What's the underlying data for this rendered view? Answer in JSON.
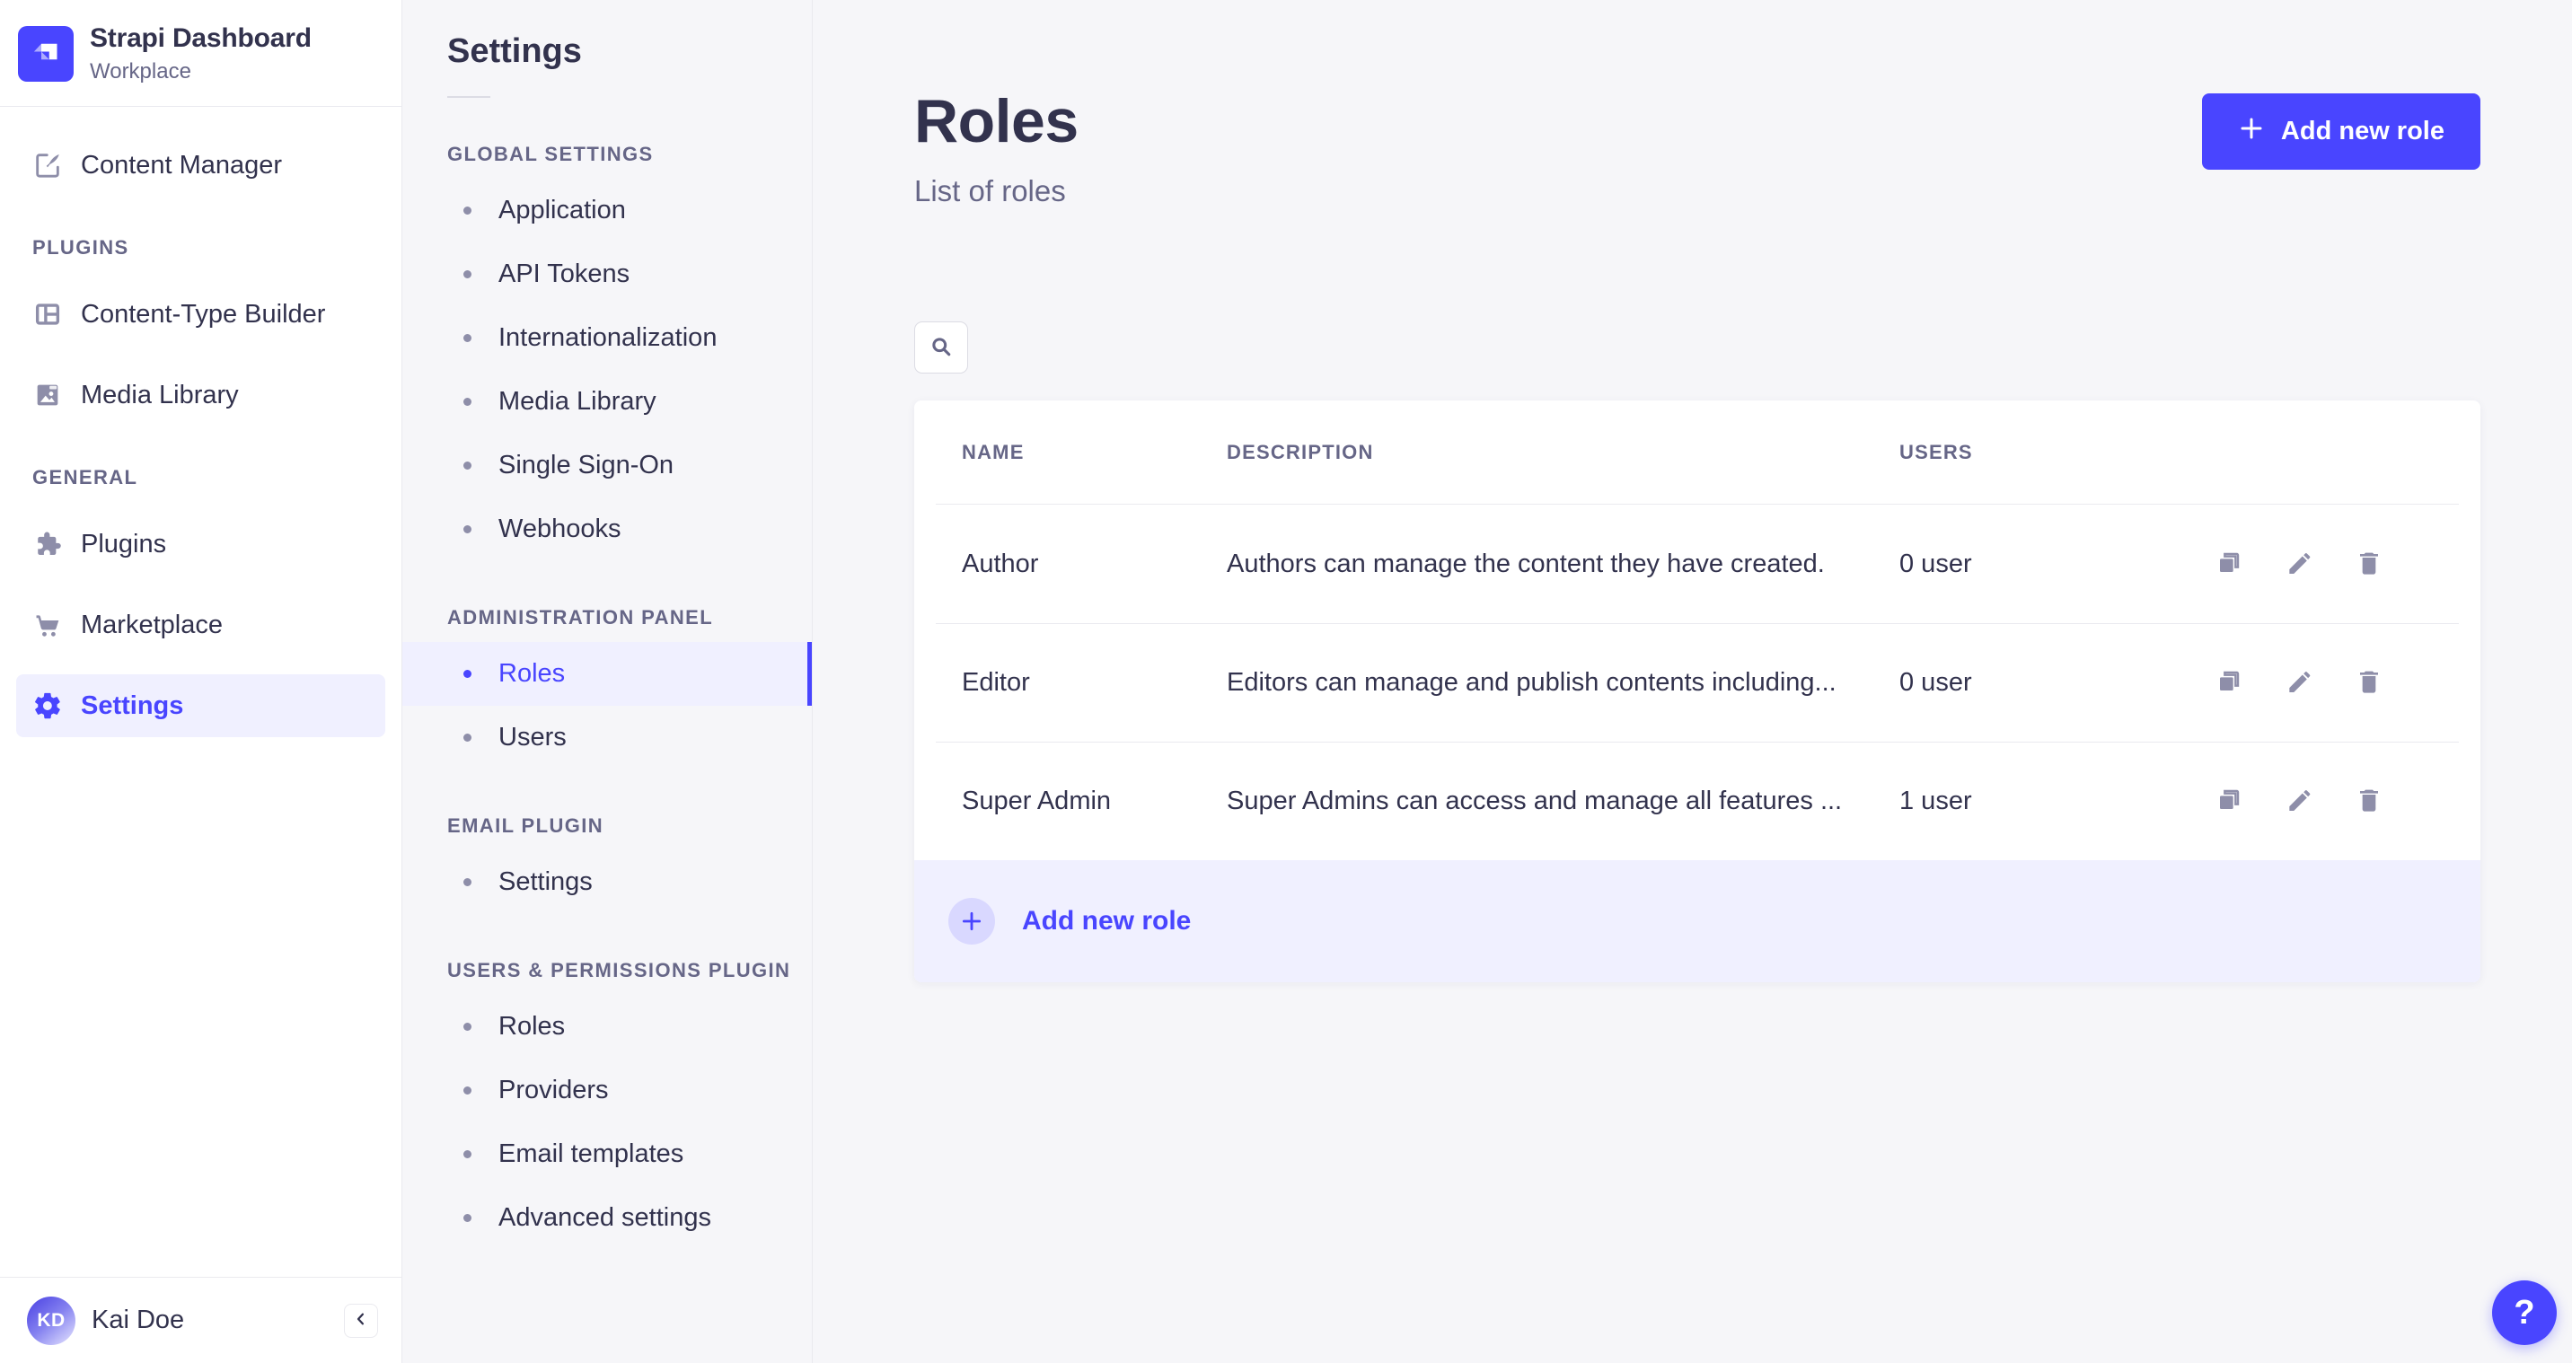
{
  "brand": {
    "name": "Strapi Dashboard",
    "workspace": "Workplace"
  },
  "sidebar": {
    "content_manager": {
      "label": "Content Manager",
      "icon": "feather-icon"
    },
    "sections": [
      {
        "label": "PLUGINS",
        "items": [
          {
            "label": "Content-Type Builder",
            "icon": "layout-icon"
          },
          {
            "label": "Media Library",
            "icon": "image-icon"
          }
        ]
      },
      {
        "label": "GENERAL",
        "items": [
          {
            "label": "Plugins",
            "icon": "puzzle-icon"
          },
          {
            "label": "Marketplace",
            "icon": "cart-icon"
          },
          {
            "label": "Settings",
            "icon": "gear-icon",
            "active": true
          }
        ]
      }
    ],
    "user": {
      "initials": "KD",
      "name": "Kai Doe"
    }
  },
  "subnav": {
    "title": "Settings",
    "sections": [
      {
        "label": "GLOBAL SETTINGS",
        "items": [
          {
            "label": "Application"
          },
          {
            "label": "API Tokens"
          },
          {
            "label": "Internationalization"
          },
          {
            "label": "Media Library"
          },
          {
            "label": "Single Sign-On"
          },
          {
            "label": "Webhooks"
          }
        ]
      },
      {
        "label": "ADMINISTRATION PANEL",
        "items": [
          {
            "label": "Roles",
            "active": true
          },
          {
            "label": "Users"
          }
        ]
      },
      {
        "label": "EMAIL PLUGIN",
        "items": [
          {
            "label": "Settings"
          }
        ]
      },
      {
        "label": "USERS & PERMISSIONS PLUGIN",
        "items": [
          {
            "label": "Roles"
          },
          {
            "label": "Providers"
          },
          {
            "label": "Email templates"
          },
          {
            "label": "Advanced settings"
          }
        ]
      }
    ]
  },
  "main": {
    "title": "Roles",
    "subtitle": "List of roles",
    "add_button_label": "Add new role",
    "table": {
      "columns": {
        "name": "NAME",
        "description": "DESCRIPTION",
        "users": "USERS"
      },
      "rows": [
        {
          "name": "Author",
          "description": "Authors can manage the content they have created.",
          "users": "0 user"
        },
        {
          "name": "Editor",
          "description": "Editors can manage and publish contents including...",
          "users": "0 user"
        },
        {
          "name": "Super Admin",
          "description": "Super Admins can access and manage all features ...",
          "users": "1 user"
        }
      ],
      "footer_add_label": "Add new role"
    },
    "help_label": "?"
  },
  "colors": {
    "primary": "#4945ff",
    "primary_light_bg": "#f0f0ff",
    "plus_badge_bg": "#d9d8ff",
    "app_bg": "#f6f6f9",
    "surface": "#ffffff",
    "border": "#eaeaef",
    "input_border": "#dcdce4",
    "text_dark": "#32324d",
    "text_muted": "#666687",
    "icon_gray": "#8e8ea9"
  }
}
